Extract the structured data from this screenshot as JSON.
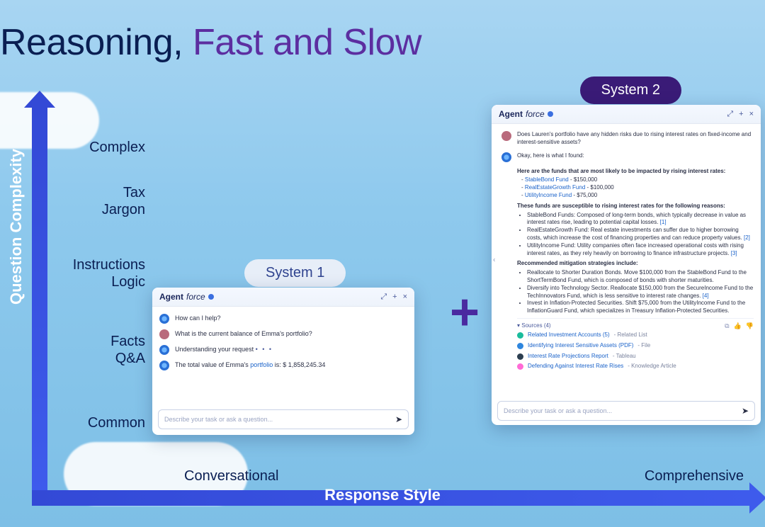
{
  "title": {
    "part1": "Reasoning, ",
    "part2": "Fast and Slow"
  },
  "axes": {
    "y_label": "Question Complexity",
    "x_label": "Response Style",
    "y_ticks": [
      "Complex",
      "Tax\nJargon",
      "Instructions\nLogic",
      "Facts\nQ&A",
      "Common"
    ],
    "x_ticks": {
      "left": "Conversational",
      "right": "Comprehensive"
    }
  },
  "pills": {
    "system1": "System 1",
    "system2": "System 2"
  },
  "brand": {
    "name": "Agent",
    "suffix": "force"
  },
  "composer_placeholder": "Describe your task or ask a question...",
  "panel1": {
    "messages": {
      "m1": "How can I help?",
      "m2": "What is the current balance of Emma's portfolio?",
      "m3_pre": "Understanding your request",
      "m4_pre": "The total value of Emma's ",
      "m4_link": "portfolio",
      "m4_post": " is: $ 1,858,245.34"
    }
  },
  "panel2": {
    "user_q": "Does Lauren's portfolio have any hidden risks due to rising interest rates on fixed-income and interest-sensitive assets?",
    "intro": "Okay, here is what I found:",
    "h1": "Here are the funds that are most likely to be impacted by rising interest rates:",
    "funds": [
      {
        "name": "StableBond Fund",
        "amt": "$150,000"
      },
      {
        "name": "RealEstateGrowth Fund",
        "amt": "$100,000"
      },
      {
        "name": "UtilityIncome Fund",
        "amt": "$75,000"
      }
    ],
    "h2": "These funds are susceptible to rising interest rates for the following reasons:",
    "reasons": [
      {
        "t": "StableBond Funds: Composed of long-term bonds, which typically decrease in value as interest rates rise, leading to potential capital losses.",
        "c": "[1]"
      },
      {
        "t": "RealEstateGrowth Fund: Real estate investments can suffer due to higher borrowing costs, which increase the cost of financing properties and can reduce property values.",
        "c": "[2]"
      },
      {
        "t": "UtilityIncome Fund: Utility companies often face increased operational costs with rising interest rates, as they rely heavily on borrowing to finance infrastructure projects.",
        "c": "[3]"
      }
    ],
    "h3": "Recommended mitigation strategies include:",
    "strategies": [
      {
        "t": "Reallocate to Shorter Duration Bonds. Move $100,000 from the StableBond Fund to the ShortTermBond Fund, which is composed of bonds with shorter maturities."
      },
      {
        "t": "Diversify into Technology Sector. Reallocate $150,000 from the SecureIncome Fund to the TechInnovators Fund, which is less sensitive to interest rate changes.",
        "c": "[4]"
      },
      {
        "t": "Invest in Inflation-Protected Securities. Shift $75,000 from the UtilityIncome Fund to the InflationGuard Fund, which specializes in Treasury Inflation-Protected Securities."
      }
    ],
    "sources_label": "Sources (4)",
    "sources": [
      {
        "name": "Related Investment Accounts (5)",
        "type": "Related List",
        "color": "d-teal"
      },
      {
        "name": "Identifying Interest Sensitive Assets (PDF)",
        "type": "File",
        "color": "d-blue"
      },
      {
        "name": "Interest Rate Projections Report",
        "type": "Tableau",
        "color": "d-dark"
      },
      {
        "name": "Defending Against Interest Rate Rises",
        "type": "Knowledge Article",
        "color": "d-pink"
      }
    ]
  },
  "chart_data": {
    "type": "scatter",
    "title": "Reasoning, Fast and Slow",
    "xlabel": "Response Style",
    "ylabel": "Question Complexity",
    "x_categories": [
      "Conversational",
      "Comprehensive"
    ],
    "y_categories": [
      "Common",
      "Facts Q&A",
      "Instructions Logic",
      "Tax Jargon",
      "Complex"
    ],
    "series": [
      {
        "name": "System 1",
        "x": "Conversational",
        "y": "Facts Q&A"
      },
      {
        "name": "System 2",
        "x": "Comprehensive",
        "y": "Complex"
      }
    ]
  }
}
